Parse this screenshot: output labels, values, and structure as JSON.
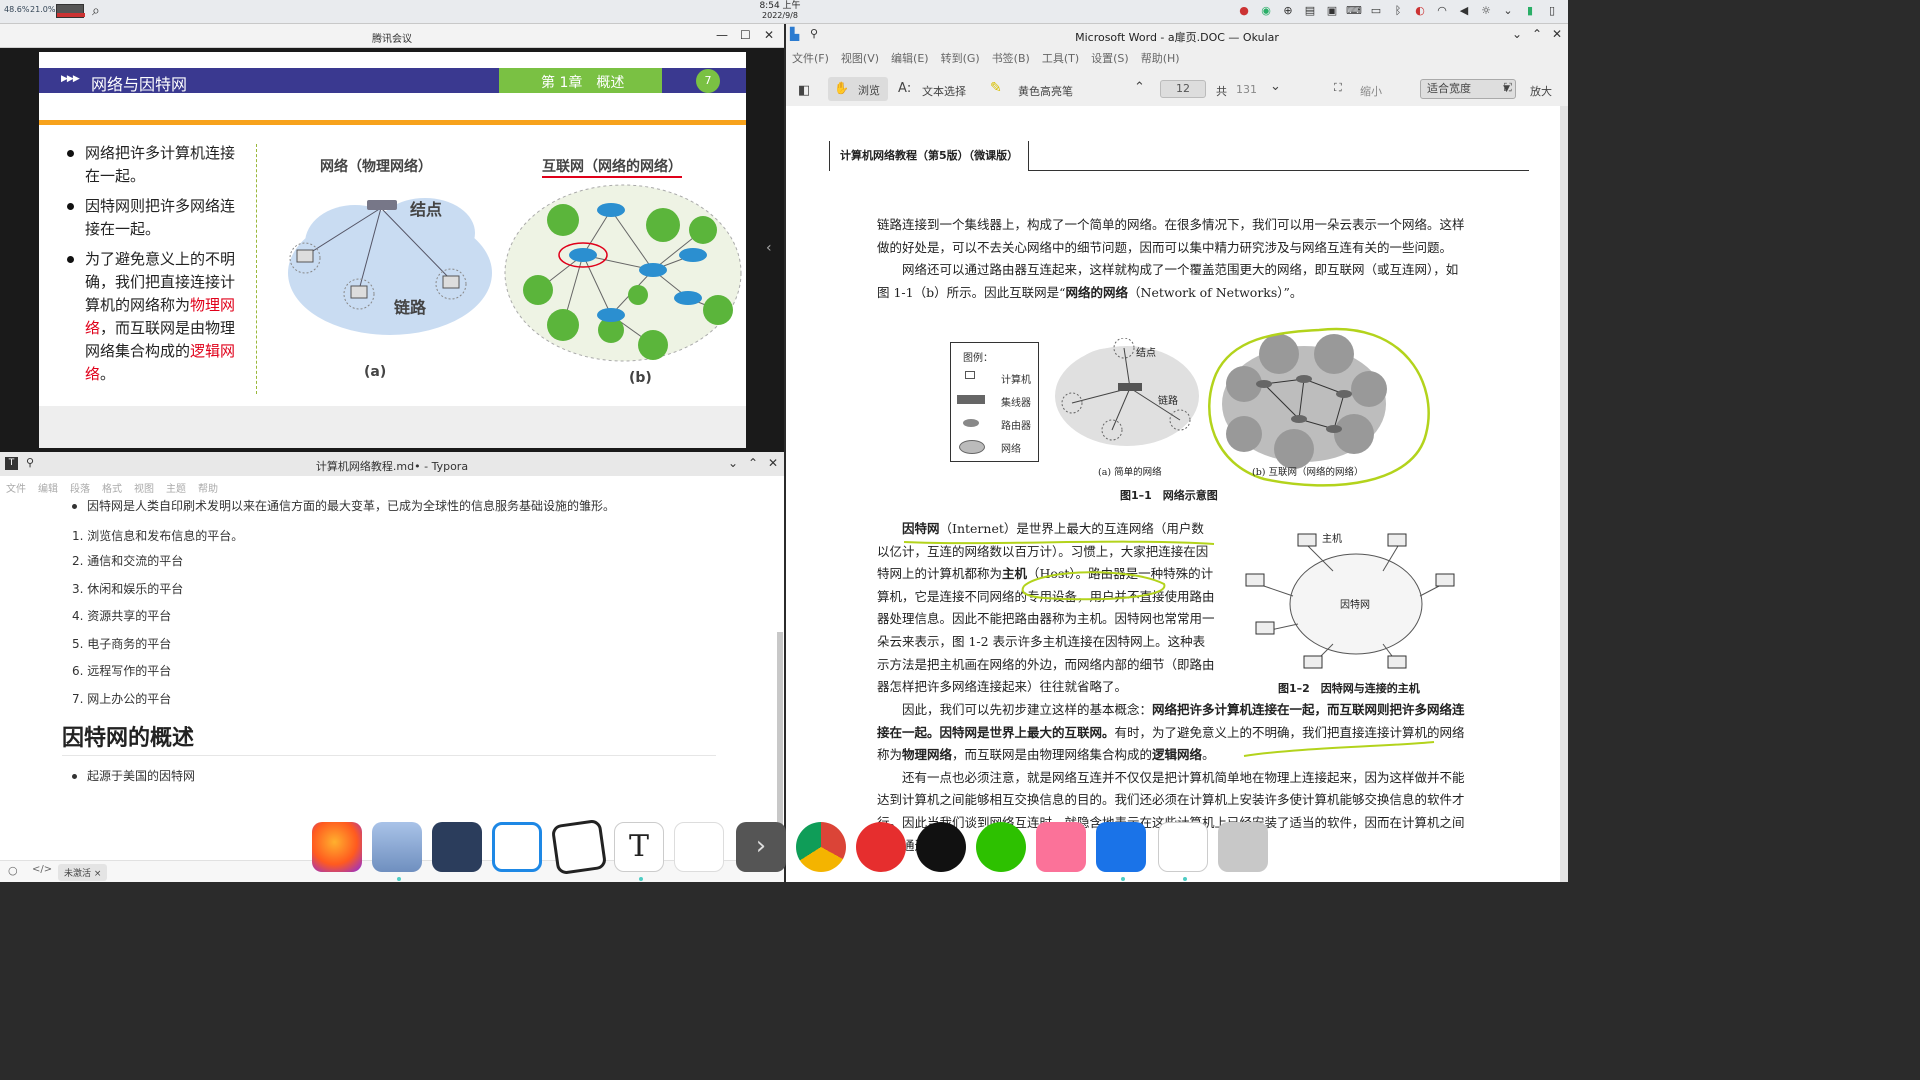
{
  "topbar": {
    "cpu": "48.6%",
    "mem": "21.0%",
    "time": "8:54 上午",
    "date": "2022/9/8"
  },
  "meeting": {
    "title": "腾讯会议",
    "slide": {
      "header": "网络与因特网",
      "chapter": "第 1章　概述",
      "page": "7",
      "bullets": [
        "网络把许多计算机连接在一起。",
        "因特网则把许多网络连接在一起。"
      ],
      "bullet3_a": "为了避免意义上的不明确，我们把直接连接计算机的网络称为",
      "bullet3_b": "物理网络",
      "bullet3_c": "，而互联网是由物理网络集合构成的",
      "bullet3_d": "逻辑网络",
      "bullet3_e": "。",
      "fig_a_title": "网络（物理网络）",
      "fig_a_node": "结点",
      "fig_a_link": "链路",
      "fig_a_caption": "(a)",
      "fig_b_title": "互联网（网络的网络）",
      "fig_b_caption": "(b)"
    }
  },
  "typora": {
    "title": "计算机网络教程.md• - Typora",
    "menu": [
      "文件",
      "编辑",
      "段落",
      "格式",
      "视图",
      "主题",
      "帮助"
    ],
    "intro_bullet": "因特网是人类自印刷术发明以来在通信方面的最大变革，已成为全球性的信息服务基础设施的雏形。",
    "list": [
      "浏览信息和发布信息的平台。",
      "通信和交流的平台",
      "休闲和娱乐的平台",
      "资源共享的平台",
      "电子商务的平台",
      "远程写作的平台",
      "网上办公的平台"
    ],
    "heading": "因特网的概述",
    "sub_bullet": "起源于美国的因特网",
    "status_badge": "未激活 ×"
  },
  "okular": {
    "title": "Microsoft Word - a扉页.DOC — Okular",
    "menu": [
      "文件(F)",
      "视图(V)",
      "编辑(E)",
      "转到(G)",
      "书签(B)",
      "工具(T)",
      "设置(S)",
      "帮助(H)"
    ],
    "tools": {
      "browse": "浏览",
      "text_select": "文本选择",
      "highlight": "黄色高亮笔",
      "page_current": "12",
      "page_of": "共",
      "page_total": "131",
      "zoom_out": "缩小",
      "zoom_mode": "适合宽度",
      "zoom_in": "放大"
    },
    "book_header": "计算机网络教程（第5版）（微课版）",
    "p1": "链路连接到一个集线器上，构成了一个简单的网络。在很多情况下，我们可以用一朵云表示一个网络。这样做的好处是，可以不去关心网络中的细节问题，因而可以集中精力研究涉及与网络互连有关的一些问题。",
    "p2_a": "网络还可以通过路由器互连起来，这样就构成了一个覆盖范围更大的网络，即互联网（或互连网），如图 1-1（b）所示。因此互联网是“",
    "p2_b": "网络的网络",
    "p2_c": "（Network of Networks）”。",
    "legend_title": "图例：",
    "legend_items": [
      "计算机",
      "集线器",
      "路由器",
      "网络"
    ],
    "fig11_node": "结点",
    "fig11_link": "链路",
    "fig11_a": "(a) 简单的网络",
    "fig11_b": "(b) 互联网（网络的网络）",
    "fig11_caption": "图1–1　网络示意图",
    "p3_a": "因特网",
    "p3_b": "（Internet）是世界上最大的互连网络（用户数以亿计，互连的网络数以百万计）。习惯上，大家把连接在因特网上的计算机都称为",
    "p3_c": "主机",
    "p3_d": "（Host）。路由器是一种特殊的计算机，它是连接不同网络的专用设备，用户并不直接使用路由器处理信息。因此不能把路由器称为主机。因特网也常常用一朵云来表示，图 1-2 表示许多主机连接在因特网上。这种表示方法是把主机画在网络的外边，而网络内部的细节（即路由器怎样把许多网络连接起来）往往就省略了。",
    "fig12_host": "主机",
    "fig12_cloud": "因特网",
    "fig12_caption": "图1–2　因特网与连接的主机",
    "p4_a": "因此，我们可以先初步建立这样的基本概念：",
    "p4_b": "网络把许多计算机连接在一起，而互联网则把许多网络连接在一起。因特网是世界上最大的互联网。",
    "p4_c": "有时，为了避免意义上的不明确，我们把直接连接计算机的网络称为",
    "p4_d": "物理网络",
    "p4_e": "，而互联网是由物理网络集合构成的",
    "p4_f": "逻辑网络",
    "p4_g": "。",
    "p5": "还有一点也必须注意，就是网络互连并不仅仅是把计算机简单地在物理上连接起来，因为这样做并不能达到计算机之间能够相互交换信息的目的。我们还必须在计算机上安装许多使计算机能够交换信息的软件才行。因此当我们谈到网络互连时，就隐含地表示在这些计算机上已经安装了适当的软件，因而在计算机之间可以通过"
  },
  "dock": [
    "firefox-icon",
    "files-icon",
    "cat-app-icon",
    "vscode-icon",
    "notes-icon",
    "typora-icon",
    "photos-icon",
    "more-icon",
    "chrome-icon",
    "netease-music-icon",
    "qq-icon",
    "wechat-icon",
    "bilibili-icon",
    "tencent-meeting-icon",
    "okular-icon",
    "trash-icon"
  ]
}
